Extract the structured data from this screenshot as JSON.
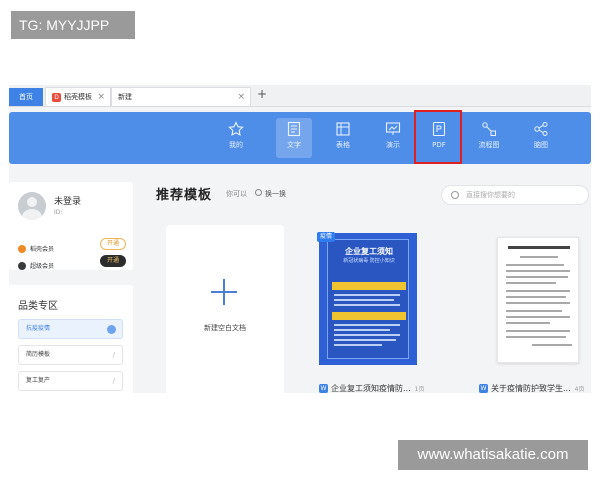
{
  "watermarks": {
    "top": "TG: MYYJJPP",
    "bottom": "www.whatisakatie.com"
  },
  "tabs": {
    "home": "首页",
    "items": [
      {
        "label": "稻壳模板"
      },
      {
        "label": "新建"
      }
    ],
    "add": "+"
  },
  "toolbar": {
    "items": [
      {
        "label": "我的",
        "icon": "star-icon"
      },
      {
        "label": "文字",
        "icon": "document-icon",
        "active": true
      },
      {
        "label": "表格",
        "icon": "table-icon"
      },
      {
        "label": "演示",
        "icon": "presentation-icon"
      },
      {
        "label": "PDF",
        "icon": "pdf-icon",
        "highlighted": true
      },
      {
        "label": "流程图",
        "icon": "flowchart-icon"
      },
      {
        "label": "脑图",
        "icon": "mindmap-icon"
      }
    ],
    "highlight_color": "#e02020"
  },
  "user": {
    "name": "未登录",
    "id": "ID:",
    "members": [
      {
        "label": "稻壳会员",
        "button": "开通",
        "color": "#f08a24"
      },
      {
        "label": "超级会员",
        "button": "开通",
        "color": "#3a3a3a"
      }
    ]
  },
  "categories": {
    "title": "品类专区",
    "items": [
      {
        "label": "抗疫疫情",
        "selected": true
      },
      {
        "label": "简历模板"
      },
      {
        "label": "复工复产"
      }
    ]
  },
  "main": {
    "title": "推荐模板",
    "hint": "你可以",
    "refresh": "换一换",
    "search_placeholder": "直接搜你想要的"
  },
  "templates": [
    {
      "label": "新建空白文档"
    },
    {
      "badge": "疫情",
      "poster_title": "企业复工须知",
      "poster_sub": "新冠状病毒\n防控小知识",
      "name": "企业复工须知疫情防...",
      "count": "1页"
    },
    {
      "name": "关于疫情防护致学生...",
      "count": "4页"
    }
  ],
  "colors": {
    "accent": "#4f8ee8",
    "tab_home": "#3f82e6"
  }
}
